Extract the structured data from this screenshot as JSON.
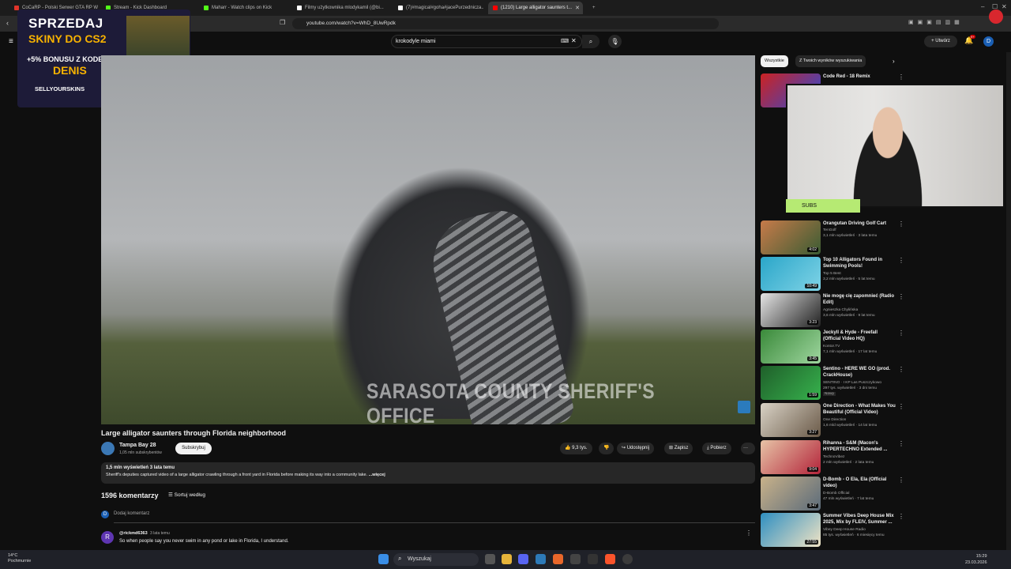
{
  "browser": {
    "tabs": [
      {
        "label": "CoCaRP - Polski Serwer GTA RP Wh...",
        "color": "#e0342a"
      },
      {
        "label": "Stream - Kick Dashboard",
        "color": "#53fc18"
      },
      {
        "label": "Maharr - Watch clips on Kick",
        "color": "#53fc18"
      },
      {
        "label": "Filmy użytkownika mlodykamil (@bi...",
        "color": "#ffffff"
      },
      {
        "label": "(7)#magical#goha#jacePurzednicza...",
        "color": "#ffffff"
      },
      {
        "label": "(1210) Large alligator saunters t...",
        "color": "#ff0000",
        "active": true
      }
    ],
    "url": "youtube.com/watch?v=WhD_8UwRpdk"
  },
  "youtube": {
    "search_query": "krokodyle miami",
    "create_label": "Utwórz",
    "notif_badge": "9+",
    "avatar_letter": "D"
  },
  "ad": {
    "line1": "SPRZEDAJ",
    "line2": "SKINY DO CS2",
    "line3": "+5% BONUSU Z KODEM",
    "line4": "DENIS",
    "brand": "SELLYOURSKINS"
  },
  "video": {
    "watermark": "SARASOTA COUNTY SHERIFF'S OFFICE",
    "title": "Large alligator saunters through Florida neighborhood",
    "channel": "Tampa Bay 28",
    "channel_subs": "1,05 mln subskrybentów",
    "subscribe_label": "Subskrybuj",
    "likes": "9,3 tys.",
    "share_label": "Udostępnij",
    "save_label": "Zapisz",
    "download_label": "Pobierz",
    "stats": "1,5 mln wyświetleń  3 lata temu",
    "description": "Sheriff's deputies captured video of a large alligator crawling through a front yard in Florida before making its way into a community lake.",
    "more_label": "...więcej"
  },
  "comments": {
    "count": "1596 komentarzy",
    "sort_label": "Sortuj według",
    "add_placeholder": "Dodaj komentarz",
    "add_avatar": "D",
    "items": [
      {
        "avatar": "R",
        "user": "@rickmd6363",
        "time": "3 lata temu",
        "text": "So when people  say you never swim in any pond or lake in Florida,  I understand."
      }
    ]
  },
  "chips": [
    {
      "label": "Wszystkie",
      "active": true
    },
    {
      "label": "Z Twoich wyników wyszukiwania",
      "active": false
    }
  ],
  "recommendations": [
    {
      "title": "Code Red - 18 Remix",
      "channel": "",
      "meta": "",
      "duration": "",
      "colors": [
        "#cc2222",
        "#2a4bd6"
      ]
    },
    {
      "title": "Orangutan Driving Golf Cart",
      "channel": "TenGolf",
      "meta": "3,1 mln wyświetleń · 3 lata temu",
      "duration": "4:02",
      "colors": [
        "#c77b4a",
        "#3b5c33"
      ]
    },
    {
      "title": "Top 10 Alligators Found in Swimming Pools!",
      "channel": "Top 5 Best",
      "meta": "3,2 mln wyświetleń · 5 lat temu",
      "duration": "10:49",
      "colors": [
        "#2aa6c9",
        "#7fd3e6"
      ]
    },
    {
      "title": "Nie mogę cię zapomnieć (Radio Edit)",
      "channel": "Agnieszka Chylińska",
      "meta": "3,6 mln wyświetleń · 9 lat temu",
      "duration": "3:23",
      "colors": [
        "#e5e5e5",
        "#222222"
      ]
    },
    {
      "title": "Jeckyll & Hyde - Freefall (Official Video HQ)",
      "channel": "Kontor.TV",
      "meta": "7,1 mln wyświetleń · 17 lat temu",
      "duration": "3:45",
      "colors": [
        "#3a8a3a",
        "#9fd69f"
      ]
    },
    {
      "title": "Sentino - HERE WE GO (prod. CrackHouse)",
      "channel": "SENTINO · I KP Las Puszczykowo",
      "meta": "297 tys. wyświetleń · 3 dni temu",
      "duration": "1:59",
      "colors": [
        "#1f5f2a",
        "#37b24d"
      ],
      "badge": "Nowy"
    },
    {
      "title": "One Direction - What Makes You Beautiful (Official Video)",
      "channel": "One Direction",
      "meta": "1,6 mld wyświetleń · 14 lat temu",
      "duration": "3:27",
      "colors": [
        "#d9d2c6",
        "#6a5a48"
      ]
    },
    {
      "title": "Rihanna - S&M (Macon's HYPERTECHNO Extended ...",
      "channel": "TechnoVibez",
      "meta": "2 mln wyświetleń · 2 lata temu",
      "duration": "9:04",
      "colors": [
        "#e7c3a6",
        "#b3243a"
      ]
    },
    {
      "title": "D-Bomb - O Ela, Ela (Official video)",
      "channel": "D-Bomb Official",
      "meta": "47 mln wyświetleń · 7 lat temu",
      "duration": "3:47",
      "colors": [
        "#c9b28a",
        "#5b6b7a"
      ]
    },
    {
      "title": "Summer Vibes Deep House Mix 2025, Mix by FLEIV, Summer ...",
      "channel": "Vibey Deep House Radio",
      "meta": "85 tys. wyświetleń · 6 miesięcy temu",
      "duration": "27:55",
      "colors": [
        "#2f8fc1",
        "#f0e3c4"
      ]
    }
  ],
  "overlay": {
    "subs_label": "SUBS"
  },
  "taskbar": {
    "temp": "14°C",
    "weather": "Pochmurnie",
    "search": "Wyszukaj",
    "time": "15:29",
    "date": "23.03.2026"
  }
}
